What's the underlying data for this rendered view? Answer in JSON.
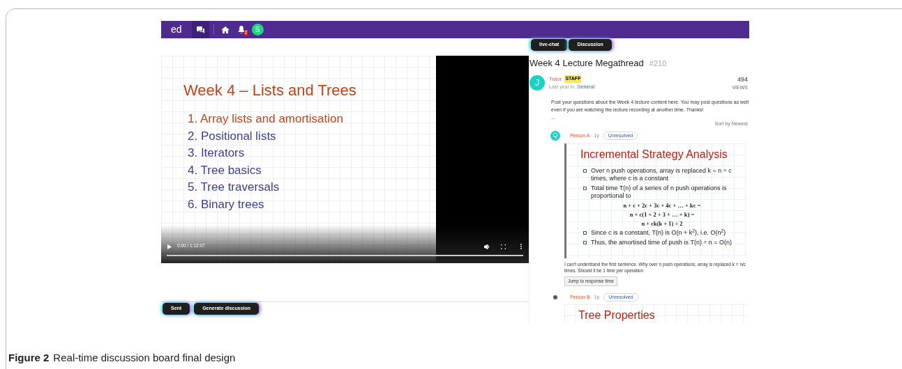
{
  "topbar": {
    "logo": "ed",
    "notification_count": "2",
    "avatar_letter": "S"
  },
  "video": {
    "slide_title": "Week 4 – Lists and Trees",
    "slide_items": [
      {
        "text": "1. Array lists and amortisation",
        "highlighted": true
      },
      {
        "text": "2. Positional lists",
        "highlighted": false
      },
      {
        "text": "3. Iterators",
        "highlighted": false
      },
      {
        "text": "4. Tree basics",
        "highlighted": false
      },
      {
        "text": "5. Tree traversals",
        "highlighted": false
      },
      {
        "text": "6. Binary trees",
        "highlighted": false
      }
    ],
    "time": "0:00 / 1:12:07"
  },
  "composer_buttons": [
    "Sent",
    "Generate discussion"
  ],
  "panel_tabs": [
    "live-chat",
    "Discussion"
  ],
  "thread": {
    "title": "Week 4 Lecture Megathread",
    "number": "#210",
    "avatar_letter": "J",
    "author": "Tutor",
    "badge": "STAFF",
    "meta_prefix": "Last year in",
    "category": "General",
    "views": "494",
    "views_label": "VIEWS",
    "body": "Post your questions about the Week 4 lecture content here. You may post questions as well even if you are watching the lecture recording at another time. Thanks!",
    "ellipsis": "...",
    "sort": "Sort by Newest"
  },
  "comments": [
    {
      "avatar_letter": "Q",
      "author": "Person A",
      "age": "1y",
      "status": "Unresolved",
      "slide": {
        "title": "Incremental Strategy Analysis",
        "lines": [
          {
            "kind": "bullet",
            "text": "Over n push operations, array is replaced k = n ÷ c times, where c is a constant"
          },
          {
            "kind": "bullet",
            "text": "Total time T(n) of a series of n push operations is proportional to"
          },
          {
            "kind": "equation",
            "text": "n + c + 2c + 3c + 4c + … + kc ="
          },
          {
            "kind": "equation",
            "text": "n + c(1 + 2 + 3 + … + k) ="
          },
          {
            "kind": "equation",
            "text": "n + ck(k + 1) ÷ 2"
          },
          {
            "kind": "bullet",
            "text": "Since c is a constant, T(n) is O(n + k$^{2}$), i.e. O(n$^{2}$)"
          },
          {
            "kind": "bullet",
            "text": "Thus, the amortised time of push is T(n) ÷ n = O(n)"
          }
        ]
      },
      "text": "I can't understand the first sentence. Why over n push operations, array is replaced k = n/c times. Should it be 1 time per operation",
      "button": "Jump to response time"
    },
    {
      "author": "Person B",
      "age": "1y",
      "status": "Unresolved",
      "slide": {
        "title": "Tree Properties"
      }
    }
  ],
  "caption": {
    "label": "Figure 2",
    "text": "Real-time discussion board final design"
  }
}
